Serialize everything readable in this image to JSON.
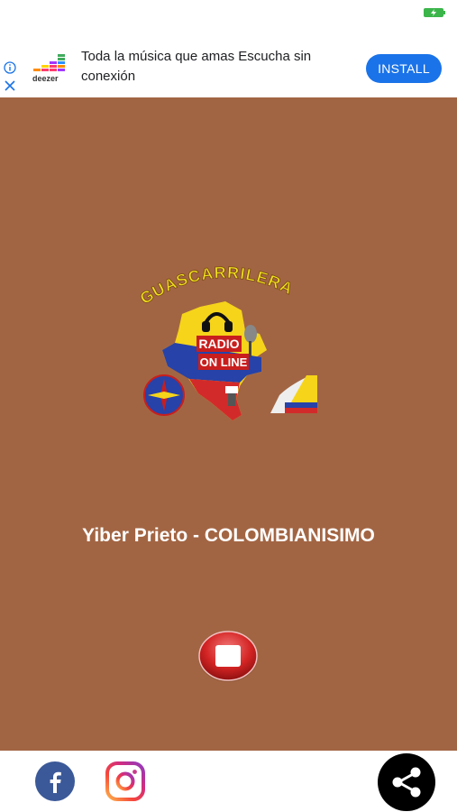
{
  "ad": {
    "brand": "deezer",
    "headline": "Toda la música que amas Escucha sin conexión",
    "install_label": "INSTALL"
  },
  "player": {
    "logo_text_top": "GUASCARRILERA",
    "logo_text_middle": "RADIO",
    "logo_text_bottom": "ON LINE",
    "now_playing": "Yiber Prieto - COLOMBIANISIMO",
    "background_color": "#a26543"
  },
  "icons": {
    "battery": "battery-charging-icon",
    "info": "info-icon",
    "close": "close-icon",
    "stop": "stop-icon",
    "facebook": "facebook-icon",
    "instagram": "instagram-icon",
    "share": "share-icon"
  }
}
